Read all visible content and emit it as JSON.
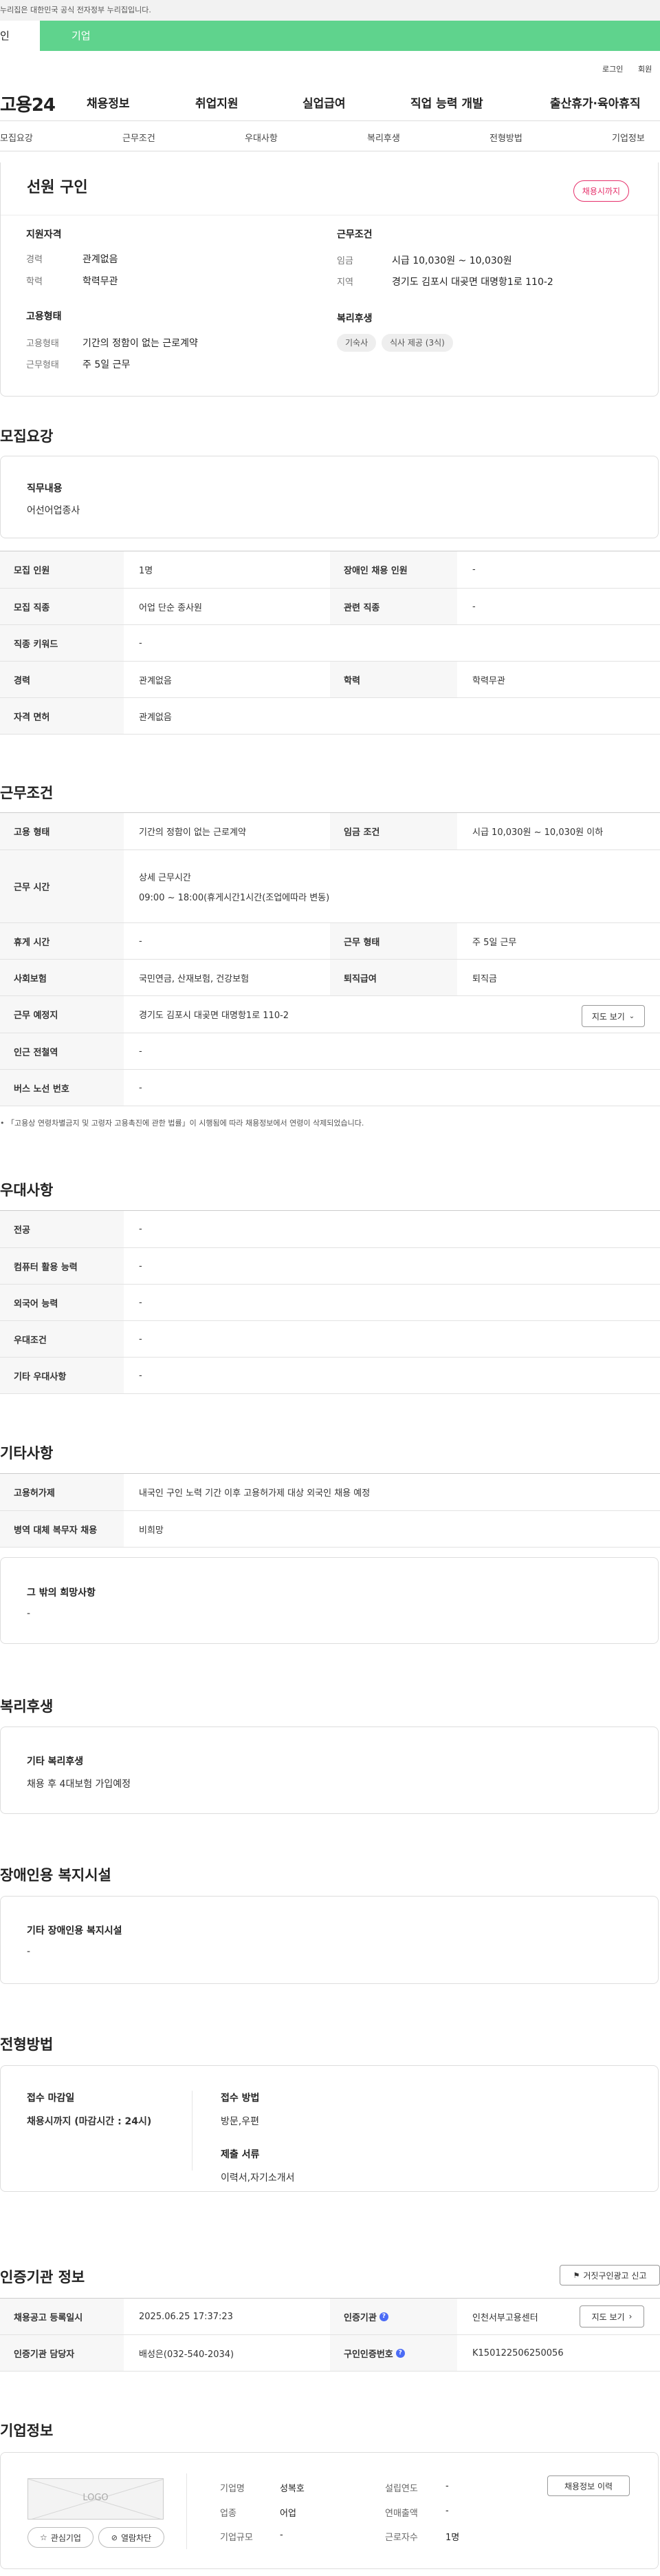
{
  "gov_bar": {
    "text": "누리집은 대한민국 공식 전자정부 누리집입니다."
  },
  "tabs": {
    "active": "인",
    "corp": "기업"
  },
  "util": {
    "login": "로그인",
    "join": "회원"
  },
  "gnb": {
    "logo": "고용24",
    "menus": [
      "채용정보",
      "취업지원",
      "실업급여",
      "직업 능력 개발",
      "출산휴가·육아휴직"
    ]
  },
  "subnav": [
    "모집요강",
    "근무조건",
    "우대사항",
    "복리후생",
    "전형방법",
    "기업정보"
  ],
  "summary": {
    "title": "선원 구인",
    "badge": "채용시까지",
    "qual_label": "지원자격",
    "career_k": "경력",
    "career_v": "관계없음",
    "edu_k": "학력",
    "edu_v": "학력무관",
    "emp_label": "고용형태",
    "emptype_k": "고용형태",
    "emptype_v": "기간의 정함이 없는 근로계약",
    "worktype_k": "근무형태",
    "worktype_v": "주 5일 근무",
    "cond_label": "근무조건",
    "wage_k": "임금",
    "wage_v": "시급 10,030원 ~ 10,030원",
    "region_k": "지역",
    "region_v": "경기도 김포시 대곶면 대명항1로 110-2",
    "welfare_label": "복리후생",
    "chips": [
      "기숙사",
      "식사 제공 (3식)"
    ]
  },
  "recruit": {
    "heading": "모집요강",
    "duty_title": "직무내용",
    "duty_value": "어선어업종사",
    "rows": [
      {
        "k1": "모집 인원",
        "v1": "1명",
        "k2": "장애인 채용 인원",
        "v2": "-"
      },
      {
        "k1": "모집 직종",
        "v1": "어업 단순 종사원",
        "k2": "관련 직종",
        "v2": "-"
      },
      {
        "k1": "직종 키워드",
        "v1": "-"
      },
      {
        "k1": "경력",
        "v1": "관계없음",
        "k2": "학력",
        "v2": "학력무관"
      },
      {
        "k1": "자격 면허",
        "v1": "관계없음"
      }
    ]
  },
  "work": {
    "heading": "근무조건",
    "emp_k": "고용 형태",
    "emp_v": "기간의 정함이 없는 근로계약",
    "wage_k": "임금 조건",
    "wage_v": "시급 10,030원 ~ 10,030원 이하",
    "time_k": "근무 시간",
    "time_sub": "상세 근무시간",
    "time_v": "09:00 ~ 18:00(휴게시간1시간(조업에따라 변동)",
    "rest_k": "휴게 시간",
    "rest_v": "-",
    "wtype_k": "근무 형태",
    "wtype_v": "주 5일 근무",
    "ins_k": "사회보험",
    "ins_v": "국민연금, 산재보험, 건강보험",
    "ret_k": "퇴직급여",
    "ret_v": "퇴직금",
    "place_k": "근무 예정지",
    "place_v": "경기도 김포시 대곶면 대명항1로 110-2",
    "map_btn": "지도 보기",
    "subway_k": "인근 전철역",
    "subway_v": "-",
    "bus_k": "버스 노선 번호",
    "bus_v": "-",
    "note": "「고용상 연령차별금지 및 고령자 고용촉진에 관한 법률」이 시행됨에 따라 채용정보에서 연령이 삭제되었습니다."
  },
  "pref": {
    "heading": "우대사항",
    "rows": [
      {
        "k": "전공",
        "v": "-"
      },
      {
        "k": "컴퓨터 활용 능력",
        "v": "-"
      },
      {
        "k": "외국어 능력",
        "v": "-"
      },
      {
        "k": "우대조건",
        "v": "-"
      },
      {
        "k": "기타 우대사항",
        "v": "-"
      }
    ]
  },
  "etc": {
    "heading": "기타사항",
    "rows": [
      {
        "k": "고용허가제",
        "v": "내국인 구인 노력 기간 이후 고용허가제 대상 외국인 채용 예정"
      },
      {
        "k": "병역 대체 복무자 채용",
        "v": "비희망"
      }
    ],
    "other_title": "그 밖의 희망사항",
    "other_value": "-"
  },
  "welfare": {
    "heading": "복리후생",
    "title": "기타 복리후생",
    "value": "채용 후 4대보험 가입예정"
  },
  "disabled": {
    "heading": "장애인용 복지시설",
    "title": "기타 장애인용 복지시설",
    "value": "-"
  },
  "process": {
    "heading": "전형방법",
    "deadline_title": "접수 마감일",
    "deadline_value": "채용시까지 (마감시간 : 24시)",
    "method_title": "접수 방법",
    "method_value": "방문,우편",
    "docs_title": "제출 서류",
    "docs_value": "이력서,자기소개서"
  },
  "auth": {
    "heading": "인증기관 정보",
    "report_btn": "거짓구인광고 신고",
    "reg_k": "채용공고 등록일시",
    "reg_v": "2025.06.25 17:37:23",
    "org_k": "인증기관",
    "org_v": "인천서부고용센터",
    "map_btn": "지도 보기",
    "mgr_k": "인증기관 담당자",
    "mgr_v": "배성은(032-540-2034)",
    "id_k": "구인인증번호",
    "id_v": "K150122506250056"
  },
  "company": {
    "heading": "기업정보",
    "logo": "LOGO",
    "fav_btn": "관심기업",
    "block_btn": "열람차단",
    "name_k": "기업명",
    "name_v": "성복호",
    "ind_k": "업종",
    "ind_v": "어업",
    "size_k": "기업규모",
    "size_v": "-",
    "year_k": "설립연도",
    "year_v": "-",
    "sales_k": "연매출액",
    "sales_v": "-",
    "emp_k": "근로자수",
    "emp_v": "1명",
    "history_btn": "채용정보 이력"
  }
}
